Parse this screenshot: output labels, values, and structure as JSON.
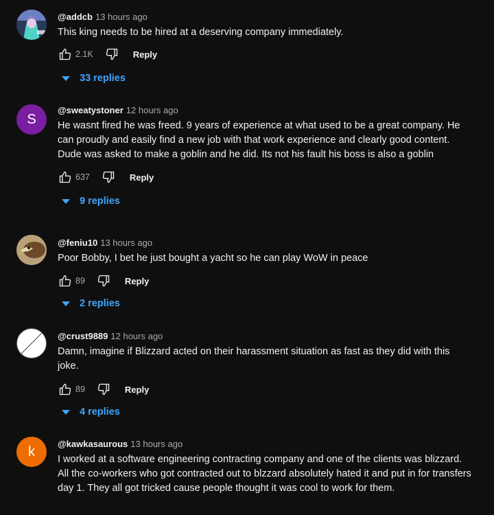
{
  "comments": [
    {
      "handle": "@addcb",
      "time": "13 hours ago",
      "text": "This king needs to be hired at a deserving company immediately.",
      "likes": "2.1K",
      "reply_label": "Reply",
      "replies_label": "33 replies",
      "avatar": {
        "type": "image",
        "desc": "anime-character-avatar"
      }
    },
    {
      "handle": "@sweatystoner",
      "time": "12 hours ago",
      "text": "He wasnt fired he was freed. 9 years of experience at what used to be a great company. He can proudly and easily find a new job with that work experience and clearly good content. Dude was asked to make a goblin and he did. Its not his fault his boss is also a goblin",
      "likes": "637",
      "reply_label": "Reply",
      "replies_label": "9 replies",
      "avatar": {
        "type": "letter",
        "letter": "S",
        "color": "#7b1fa2"
      }
    },
    {
      "handle": "@feniu10",
      "time": "13 hours ago",
      "text": "Poor Bobby, I bet he just bought a yacht so he can play WoW in peace",
      "likes": "89",
      "reply_label": "Reply",
      "replies_label": "2 replies",
      "avatar": {
        "type": "image",
        "desc": "eagle-photo-avatar"
      }
    },
    {
      "handle": "@crust9889",
      "time": "12 hours ago",
      "text": "Damn, imagine if Blizzard acted on their harassment situation as fast as they did with this joke.",
      "likes": "89",
      "reply_label": "Reply",
      "replies_label": "4 replies",
      "avatar": {
        "type": "image",
        "desc": "white-circle-avatar"
      }
    },
    {
      "handle": "@kawkasaurous",
      "time": "13 hours ago",
      "text": "I worked at a software engineering contracting company and one of the clients was blizzard. All the co-workers who got contracted out to blzzard absolutely hated it and put in for transfers day 1. They all got tricked cause people thought it was cool to work for them.",
      "avatar": {
        "type": "letter",
        "letter": "k",
        "color": "#ef6c00"
      }
    }
  ],
  "colors": {
    "background": "#0f0f0f",
    "link_blue": "#3ea6ff",
    "secondary_text": "#aaaaaa"
  }
}
